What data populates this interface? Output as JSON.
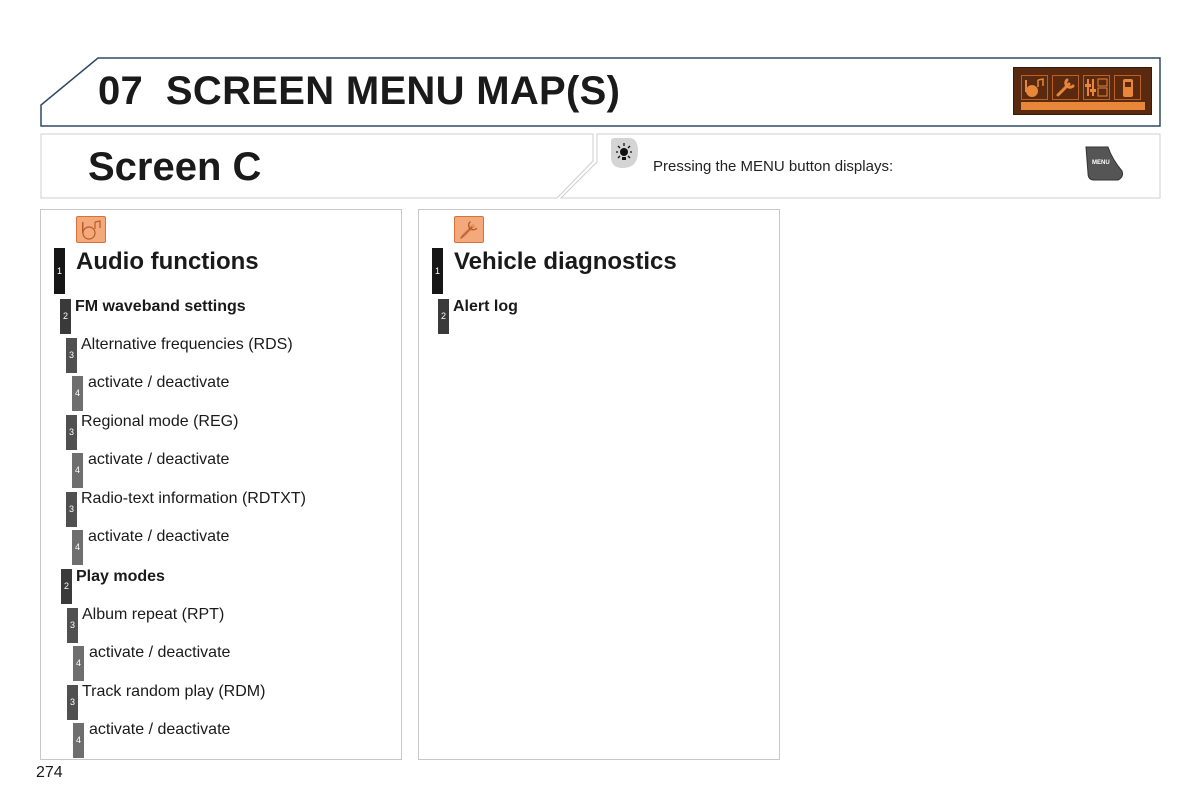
{
  "chapter": {
    "number": "07",
    "title": "SCREEN MENU MAP(S)",
    "icon_strip": [
      "audio-icon",
      "wrench-icon",
      "settings-sliders-icon",
      "phone-icon"
    ],
    "accent_color": "#e8863a",
    "strip_bg_color": "#5a2a10"
  },
  "screen": {
    "title": "Screen C",
    "info_text": "Pressing the MENU button displays:",
    "menu_key_label": "MENU"
  },
  "panels": [
    {
      "icon": "audio-icon",
      "items": [
        {
          "level": "1",
          "label": "Audio functions"
        },
        {
          "level": "2",
          "label": "FM waveband settings"
        },
        {
          "level": "3",
          "label": "Alternative frequencies (RDS)"
        },
        {
          "level": "4",
          "label": "activate / deactivate"
        },
        {
          "level": "3",
          "label": "Regional mode (REG)"
        },
        {
          "level": "4",
          "label": "activate / deactivate"
        },
        {
          "level": "3",
          "label": "Radio-text information (RDTXT)"
        },
        {
          "level": "4",
          "label": "activate / deactivate"
        },
        {
          "level": "2",
          "label": "Play modes"
        },
        {
          "level": "3",
          "label": "Album repeat (RPT)"
        },
        {
          "level": "4",
          "label": "activate / deactivate"
        },
        {
          "level": "3",
          "label": "Track random play (RDM)"
        },
        {
          "level": "4",
          "label": "activate / deactivate"
        }
      ]
    },
    {
      "icon": "wrench-icon",
      "items": [
        {
          "level": "1",
          "label": "Vehicle diagnostics"
        },
        {
          "level": "2",
          "label": "Alert log"
        }
      ]
    }
  ],
  "page_number": "274"
}
